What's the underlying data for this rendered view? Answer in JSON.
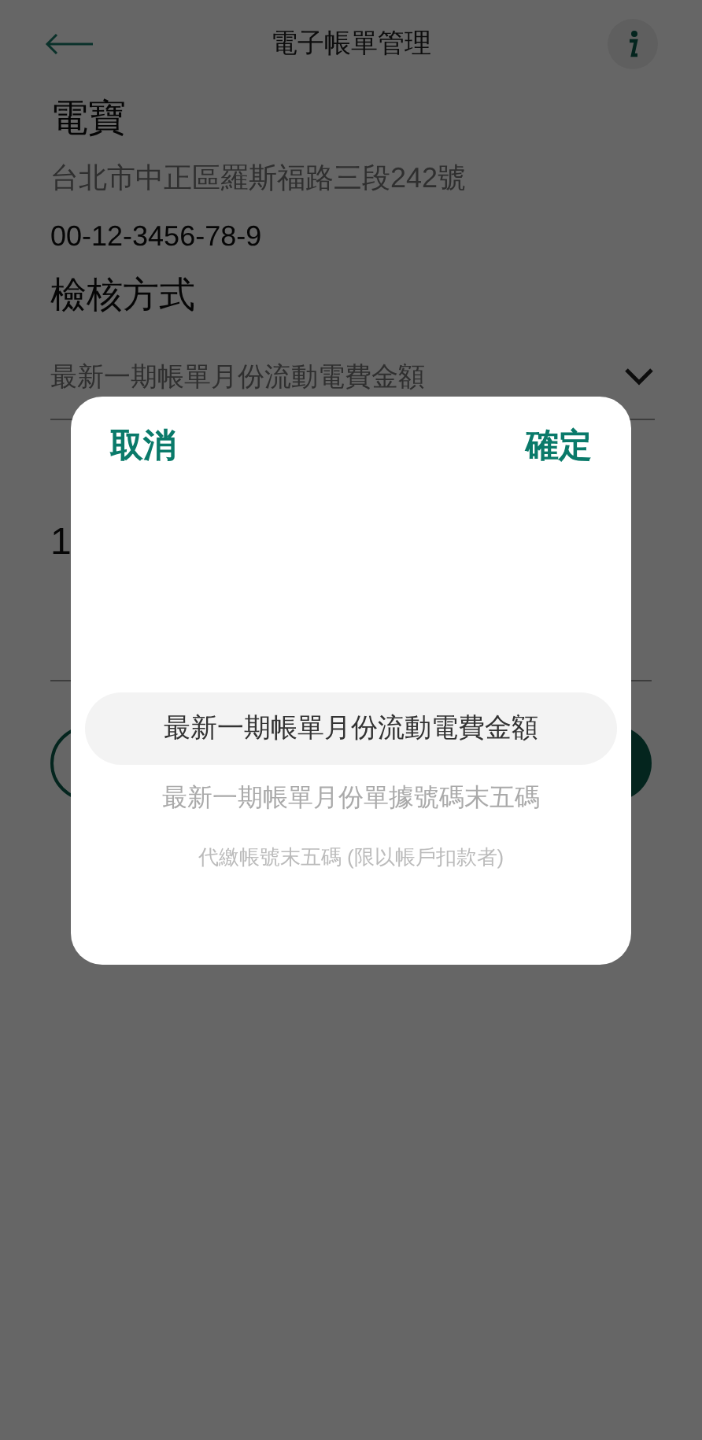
{
  "header": {
    "title": "電子帳單管理"
  },
  "account": {
    "name": "電寶",
    "address": "台北市中正區羅斯福路三段242號",
    "number": "00-12-3456-78-9"
  },
  "verify": {
    "heading": "檢核方式",
    "value": "最新一期帳單月份流動電費金額"
  },
  "behind": {
    "amount": "1"
  },
  "picker": {
    "cancel": "取消",
    "confirm": "確定",
    "options": [
      {
        "label": "最新一期帳單月份流動電費金額",
        "selected": true
      },
      {
        "label": "最新一期帳單月份單據號碼末五碼",
        "selected": false
      },
      {
        "label": "代繳帳號末五碼 (限以帳戶扣款者)",
        "selected": false
      }
    ]
  }
}
